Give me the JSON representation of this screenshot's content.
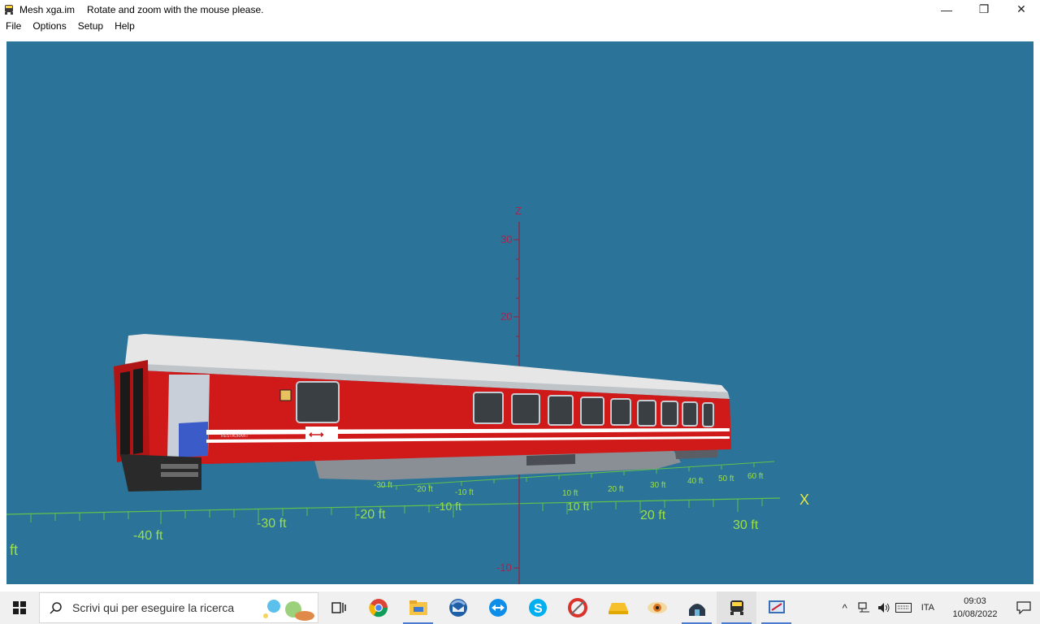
{
  "window": {
    "app_title": "Mesh xga.im",
    "message": "Rotate and zoom with the mouse please.",
    "minimize": "—",
    "maximize": "❐",
    "close": "✕"
  },
  "menu": [
    "File",
    "Options",
    "Setup",
    "Help"
  ],
  "scene": {
    "background": "#2b7399",
    "z_axis": {
      "label": "Z",
      "ticks": [
        "30",
        "20",
        "-10"
      ]
    },
    "x_axis": {
      "label": "X",
      "ticks": [
        "-40 ft",
        "-30 ft",
        "-20 ft",
        "-10 ft",
        "10 ft",
        "20 ft",
        "30 ft"
      ]
    },
    "y_axis": {
      "ticks": [
        "-30 ft",
        "-20 ft",
        "-10 ft",
        "10 ft",
        "20 ft",
        "30 ft",
        "40 ft",
        "50 ft",
        "60 ft"
      ]
    },
    "edge_label": "ft",
    "train": {
      "body_color": "#d01a1a",
      "roof_color": "#e6e6e6",
      "side_text": "RESTAURANT",
      "logo": "SBB"
    }
  },
  "taskbar": {
    "search_placeholder": "Scrivi qui per eseguire la ricerca",
    "apps": [
      "task-view",
      "chrome",
      "file-explorer",
      "thunderbird",
      "teamviewer",
      "skype",
      "ccleaner",
      "drive",
      "viewer",
      "dome",
      "mesh-app",
      "editor"
    ],
    "tray": {
      "lang": "ITA",
      "time": "09:03",
      "date": "10/08/2022"
    }
  }
}
